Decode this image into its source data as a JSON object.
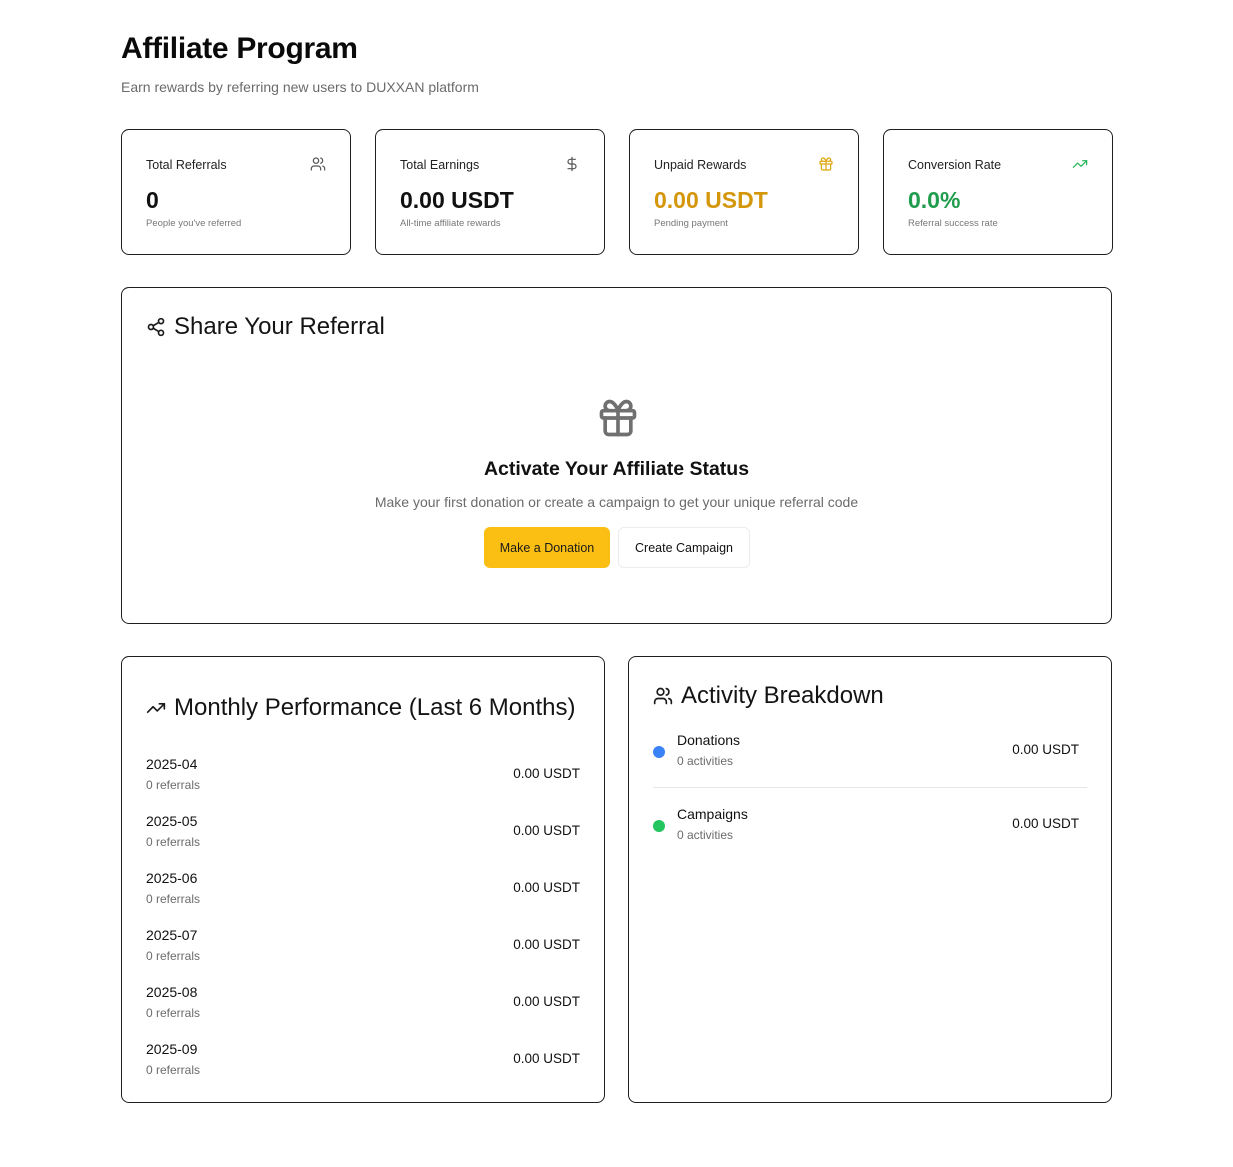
{
  "header": {
    "title": "Affiliate Program",
    "subtitle": "Earn rewards by referring new users to DUXXAN platform"
  },
  "stats": [
    {
      "label": "Total Referrals",
      "value": "0",
      "hint": "People you've referred",
      "icon": "users-icon"
    },
    {
      "label": "Total Earnings",
      "value": "0.00 USDT",
      "hint": "All-time affiliate rewards",
      "icon": "dollar-icon"
    },
    {
      "label": "Unpaid Rewards",
      "value": "0.00 USDT",
      "hint": "Pending payment",
      "icon": "gift-icon",
      "color": "#d4960a"
    },
    {
      "label": "Conversion Rate",
      "value": "0.0%",
      "hint": "Referral success rate",
      "icon": "trending-up-icon",
      "color": "#1f9d4c"
    }
  ],
  "share": {
    "title": "Share Your Referral",
    "activate_title": "Activate Your Affiliate Status",
    "activate_text": "Make your first donation or create a campaign to get your unique referral code",
    "primary_button": "Make a Donation",
    "secondary_button": "Create Campaign",
    "accent_color": "#fbbf14"
  },
  "monthly": {
    "title": "Monthly Performance (Last 6 Months)",
    "rows": [
      {
        "month": "2025-04",
        "referrals": "0 referrals",
        "amount": "0.00 USDT"
      },
      {
        "month": "2025-05",
        "referrals": "0 referrals",
        "amount": "0.00 USDT"
      },
      {
        "month": "2025-06",
        "referrals": "0 referrals",
        "amount": "0.00 USDT"
      },
      {
        "month": "2025-07",
        "referrals": "0 referrals",
        "amount": "0.00 USDT"
      },
      {
        "month": "2025-08",
        "referrals": "0 referrals",
        "amount": "0.00 USDT"
      },
      {
        "month": "2025-09",
        "referrals": "0 referrals",
        "amount": "0.00 USDT"
      }
    ]
  },
  "activity": {
    "title": "Activity Breakdown",
    "rows": [
      {
        "name": "Donations",
        "count": "0 activities",
        "amount": "0.00 USDT",
        "color": "#3b82f6"
      },
      {
        "name": "Campaigns",
        "count": "0 activities",
        "amount": "0.00 USDT",
        "color": "#22c55e"
      }
    ]
  }
}
